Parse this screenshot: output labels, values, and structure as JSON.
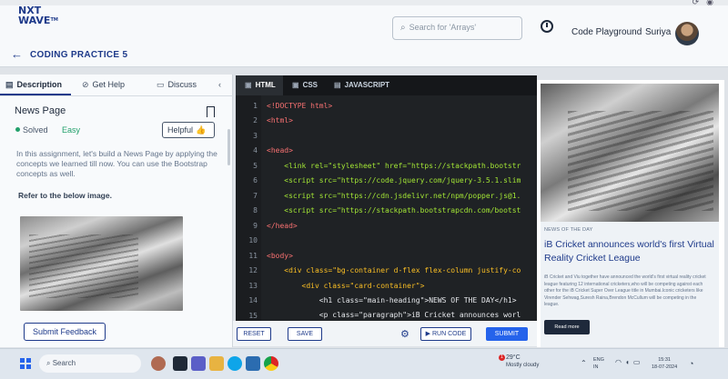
{
  "header": {
    "logo_line1": "NXT",
    "logo_line2": "WAVE",
    "logo_tm": "TM",
    "search_placeholder": "Search for 'Arrays'",
    "code_playground": "Code Playground",
    "user_name": "Suriya"
  },
  "practice": {
    "title": "CODING PRACTICE 5"
  },
  "left_panel": {
    "tabs": [
      {
        "label": "Description",
        "icon": "document-icon"
      },
      {
        "label": "Get Help",
        "icon": "help-circle-icon"
      },
      {
        "label": "Discuss",
        "icon": "chat-icon"
      }
    ],
    "problem_title": "News Page",
    "status": "Solved",
    "difficulty": "Easy",
    "helpful_label": "Helpful",
    "description": "In this assignment, let's build a News Page by applying the concepts we learned till now. You can use the Bootstrap concepts as well.",
    "refer_text": "Refer to the below image.",
    "submit_feedback": "Submit Feedback"
  },
  "editor": {
    "tabs": [
      "HTML",
      "CSS",
      "JAVASCRIPT"
    ],
    "line_numbers": [
      "1",
      "2",
      "3",
      "4",
      "5",
      "6",
      "7",
      "8",
      "9",
      "10",
      "11",
      "12",
      "13",
      "14",
      "15"
    ],
    "lines": [
      "<!DOCTYPE html>",
      "<html>",
      "",
      "<head>",
      "    <link rel=\"stylesheet\" href=\"https://stackpath.bootstr",
      "    <script src=\"https://code.jquery.com/jquery-3.5.1.slim",
      "    <script src=\"https://cdn.jsdelivr.net/npm/popper.js@1.",
      "    <script src=\"https://stackpath.bootstrapcdn.com/bootst",
      "</head>",
      "",
      "<body>",
      "    <div class=\"bg-container d-flex flex-column justify-co",
      "        <div class=\"card-container\">",
      "            <h1 class=\"main-heading\">NEWS OF THE DAY</h1>",
      "            <p class=\"paragraph\">iB Cricket announces worl"
    ]
  },
  "toolbar": {
    "reset": "RESET",
    "save": "SAVE",
    "run_code": "RUN CODE",
    "submit": "SUBMIT"
  },
  "preview": {
    "news_of_day": "NEWS OF THE DAY",
    "heading": "iB Cricket announces world's first Virtual Reality Cricket League",
    "paragraph": "iB Cricket and Viu together have announced the world's first virtual reality cricket league featuring 12 international cricketers,who will be competing against each other for the iB Cricket Super Over League title in Mumbai.Iconic cricketers like Virender Sehwag,Suresh Raina,Brendon McCullum will be competing in the league.",
    "read_more": "Read more"
  },
  "taskbar": {
    "search": "Search",
    "weather_temp": "29°C",
    "weather_desc": "Mostly cloudy",
    "weather_badge": "1",
    "lang1": "ENG",
    "lang2": "IN",
    "time": "15:31",
    "date": "18-07-2024"
  },
  "colors": {
    "brand": "#1e3a8a",
    "submit": "#2563eb",
    "solved": "#22a06b",
    "editor_bg": "#1f2225"
  }
}
